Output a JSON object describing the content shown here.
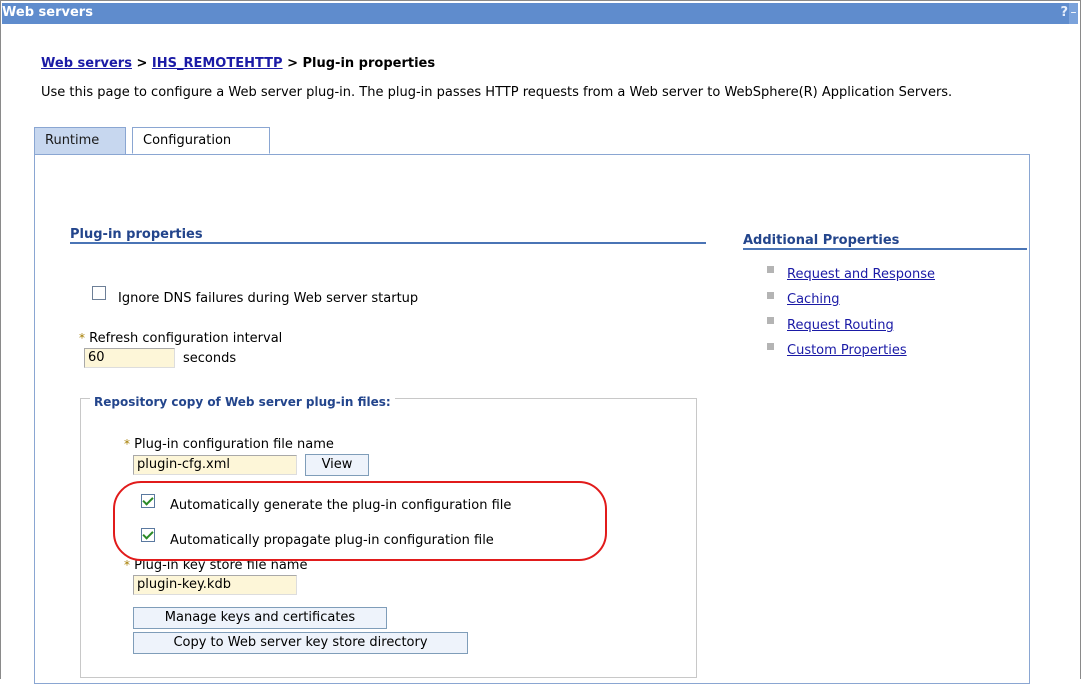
{
  "window": {
    "title": "Web servers",
    "help_icon": "?",
    "minimize_icon": "–"
  },
  "breadcrumb": {
    "item1": "Web servers",
    "sep1": " > ",
    "item2": "IHS_REMOTEHTTP",
    "sep2": " > ",
    "current": "Plug-in properties"
  },
  "description": "Use this page to configure a Web server plug-in. The plug-in passes HTTP requests from a Web server to WebSphere(R) Application Servers.",
  "tabs": [
    {
      "label": "Runtime"
    },
    {
      "label": "Configuration",
      "active": true
    }
  ],
  "plugin_properties": {
    "title": "Plug-in properties",
    "ignore_dns": {
      "label": "Ignore DNS failures during Web server startup",
      "checked": false
    },
    "refresh": {
      "required_marker": "*",
      "label": "Refresh configuration interval",
      "value": "60",
      "unit": "seconds"
    }
  },
  "repository": {
    "legend": "Repository copy of Web server plug-in files:",
    "config_file": {
      "required_marker": "*",
      "label": "Plug-in configuration file name",
      "value": "plugin-cfg.xml",
      "view_button": "View"
    },
    "auto_generate": {
      "label": "Automatically generate the plug-in configuration file",
      "checked": true
    },
    "auto_propagate": {
      "label": "Automatically propagate plug-in configuration file",
      "checked": true
    },
    "keystore": {
      "required_marker": "*",
      "label": "Plug-in key store file name",
      "value": "plugin-key.kdb"
    },
    "manage_button": "Manage keys and certificates",
    "copy_button": "Copy to Web server key store directory"
  },
  "additional": {
    "title": "Additional Properties",
    "links": [
      "Request and Response",
      "Caching",
      "Request Routing",
      "Custom Properties"
    ]
  },
  "colors": {
    "titlebar": "#5f8ccd",
    "link": "#1a1aa6",
    "section": "#23458c",
    "highlight": "#e11b1b",
    "input_bg": "#fdf6d8"
  }
}
